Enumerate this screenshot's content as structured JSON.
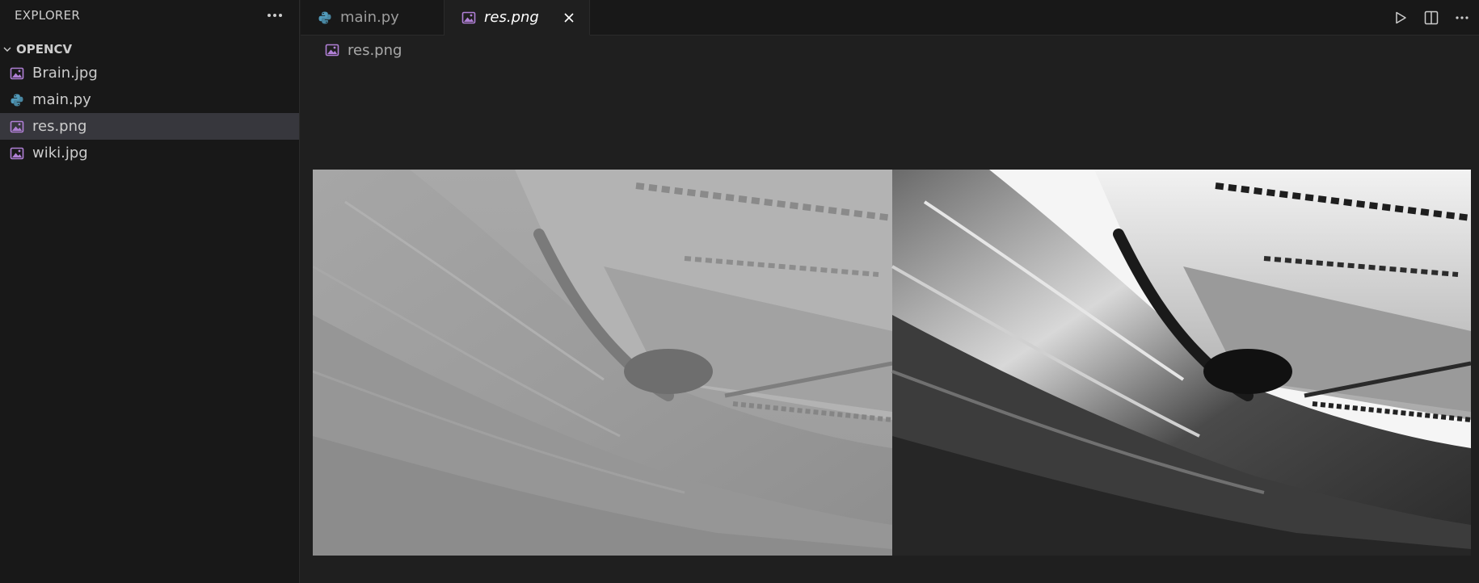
{
  "sidebar": {
    "title": "EXPLORER",
    "more_icon": "more-horizontal-icon",
    "folder": {
      "name": "OPENCV",
      "icon": "chevron-down-icon"
    },
    "files": [
      {
        "name": "Brain.jpg",
        "icon": "image-file-icon"
      },
      {
        "name": "main.py",
        "icon": "python-file-icon"
      },
      {
        "name": "res.png",
        "icon": "image-file-icon",
        "selected": true
      },
      {
        "name": "wiki.jpg",
        "icon": "image-file-icon"
      }
    ]
  },
  "tabs": [
    {
      "label": "main.py",
      "icon": "python-file-icon",
      "active": false
    },
    {
      "label": "res.png",
      "icon": "image-file-icon",
      "active": true,
      "close_icon": "close-icon"
    }
  ],
  "actions": [
    {
      "name": "run",
      "icon": "play-icon"
    },
    {
      "name": "split-editor",
      "icon": "split-editor-icon"
    },
    {
      "name": "more-actions",
      "icon": "more-horizontal-icon"
    }
  ],
  "breadcrumb": {
    "file": "res.png",
    "icon": "image-file-icon"
  },
  "colors": {
    "sidebar_bg": "#181818",
    "editor_bg": "#1f1f1f",
    "selected_bg": "#37373d",
    "image_icon": "#b180d7",
    "python_icon_blue": "#519aba",
    "text": "#cccccc"
  }
}
